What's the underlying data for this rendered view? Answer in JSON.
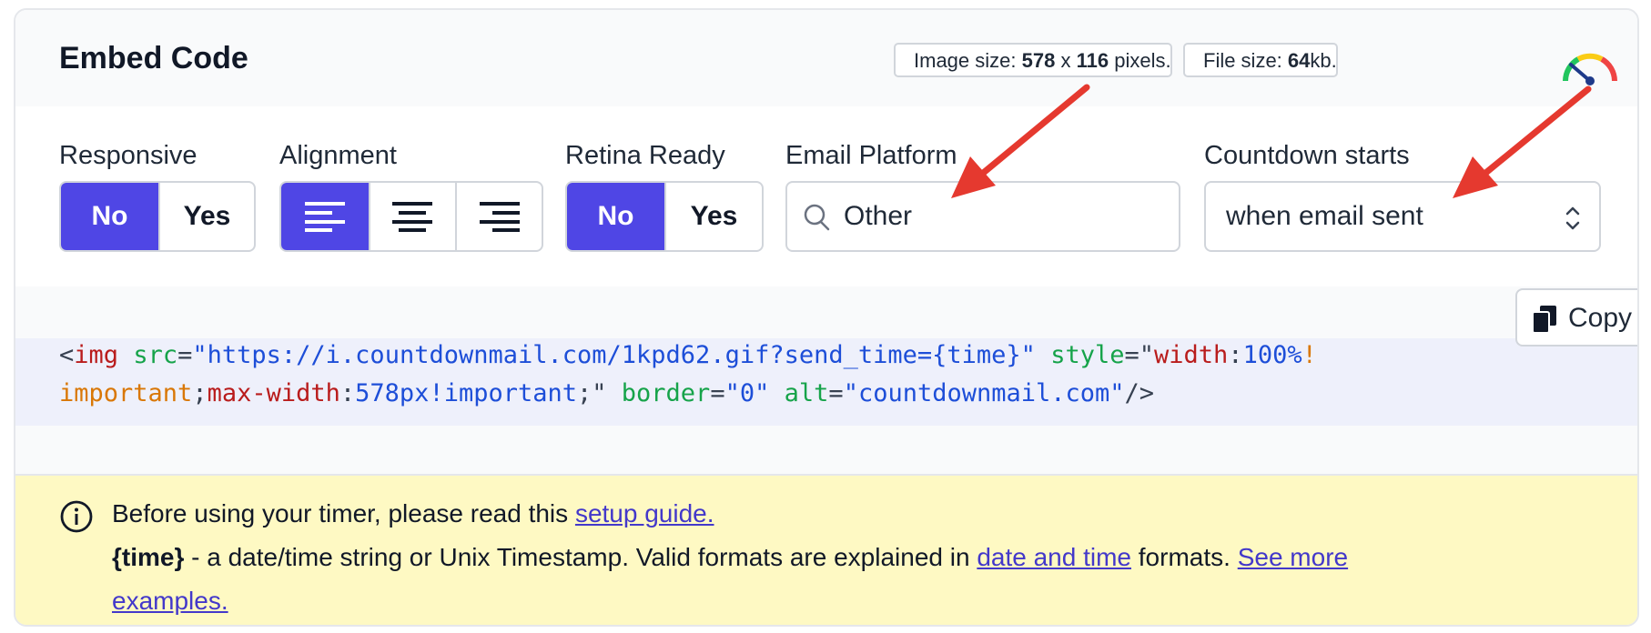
{
  "header": {
    "title": "Embed Code",
    "image_size_label": "Image size:",
    "image_size_w": "578",
    "image_size_x": "x",
    "image_size_h": "116",
    "image_size_unit": "pixels.",
    "file_size_label": "File size:",
    "file_size_value": "64",
    "file_size_unit": "kb."
  },
  "controls": {
    "responsive": {
      "label": "Responsive",
      "options": [
        "No",
        "Yes"
      ],
      "selected": "No"
    },
    "alignment": {
      "label": "Alignment",
      "options": [
        "align-left-icon",
        "align-center-icon",
        "align-right-icon"
      ],
      "selected": "align-left-icon"
    },
    "retina": {
      "label": "Retina Ready",
      "options": [
        "No",
        "Yes"
      ],
      "selected": "No"
    },
    "email_platform": {
      "label": "Email Platform",
      "value": "Other",
      "icon": "search-icon"
    },
    "countdown_starts": {
      "label": "Countdown starts",
      "value": "when email sent",
      "icon": "select-chevrons-icon"
    }
  },
  "code": {
    "copy_label": "Copy",
    "line1": {
      "open": "<",
      "tag": "img",
      "attr_src": "src",
      "eq": "=",
      "q": "\"",
      "src_value": "https://i.countdownmail.com/1kpd62.gif?send_time={time}",
      "attr_style": "style",
      "prop_width": "width",
      "colon": ":",
      "width_value": "100%",
      "bang": "!"
    },
    "line2": {
      "important1": "important",
      "semi": ";",
      "prop_maxwidth": "max-width",
      "colon": ":",
      "maxwidth_value": "578px!important",
      "semi_quote": ";\"",
      "attr_border": "border",
      "eq": "=",
      "border_value": "\"0\"",
      "attr_alt": "alt",
      "alt_value": "\"countdownmail.com\"",
      "close": "/>"
    }
  },
  "info": {
    "icon": "info-circle-icon",
    "line1_text": "Before using your timer, please read this ",
    "setup_guide_link": "setup guide.",
    "time_token": "{time}",
    "line2_text": " - a date/time string or Unix Timestamp. Valid formats are explained in ",
    "date_time_link": "date and time",
    "formats_text": " formats. ",
    "see_more_link": "See more",
    "examples_link": "examples."
  },
  "colors": {
    "accent": "#4f46e5",
    "info_background": "#fef9c3",
    "link": "#4338ca",
    "annotation_arrow": "#e5392f"
  }
}
